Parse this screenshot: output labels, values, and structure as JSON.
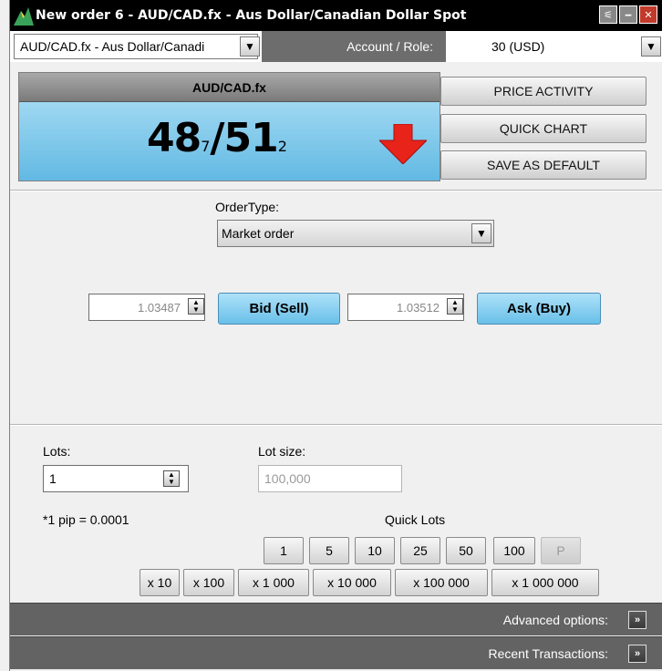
{
  "window": {
    "title": "New order 6 - AUD/CAD.fx - Aus Dollar/Canadian Dollar Spot",
    "minimize_glyph": "🗕",
    "restore_glyph": "🗗",
    "close_glyph": "✕",
    "shade_glyph": "⚟"
  },
  "topbar": {
    "instrument": "AUD/CAD.fx - Aus Dollar/Canadi",
    "account_label": "Account / Role:",
    "account_value": "30 (USD)"
  },
  "quote": {
    "symbol": "AUD/CAD.fx",
    "bid_big": "48",
    "bid_small": "7",
    "separator": "/",
    "ask_big": "51",
    "ask_small": "2",
    "direction": "down-arrow-icon",
    "arrow_color": "#e8231a"
  },
  "side_buttons": {
    "price_activity": "PRICE ACTIVITY",
    "quick_chart": "QUICK CHART",
    "save_default": "SAVE AS DEFAULT"
  },
  "order": {
    "type_label": "OrderType:",
    "type_value": "Market order",
    "bid_price": "1.03487",
    "bid_button": "Bid (Sell)",
    "ask_price": "1.03512",
    "ask_button": "Ask (Buy)"
  },
  "lots": {
    "lots_label": "Lots:",
    "lots_value": "1",
    "lot_size_label": "Lot size:",
    "lot_size_placeholder": "100,000",
    "pip_note": "*1 pip = 0.0001",
    "quick_lots_label": "Quick Lots",
    "quick_lots": [
      "1",
      "5",
      "10",
      "25",
      "50",
      "100",
      "P"
    ],
    "multipliers": [
      "x 10",
      "x 100",
      "x 1 000",
      "x 10 000",
      "x 100 000",
      "x 1 000 000"
    ]
  },
  "bottom": {
    "advanced": "Advanced options:",
    "recent": "Recent Transactions:",
    "expand_glyph": "»"
  },
  "colors": {
    "quote_bg": "#62b9e3",
    "button_blue": "#69bfe9",
    "bar_gray": "#636363"
  }
}
